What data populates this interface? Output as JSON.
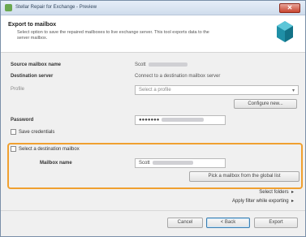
{
  "window": {
    "title": "Stellar Repair for Exchange - Preview",
    "close_label": "✕"
  },
  "header": {
    "title": "Export to mailbox",
    "description": "Select option to save the repaired mailboxes to live exchange server. This tool exports data to the server mailbox.",
    "logo_icon": "exchange-logo-icon"
  },
  "form": {
    "source_label": "Source mailbox name",
    "source_value": "Scott",
    "dest_server_label": "Destination server",
    "dest_server_value": "Connect to a destination mailbox server",
    "profile_label": "Profile",
    "profile_value": "Select a profile",
    "profile_button": "Configure new...",
    "password_label": "Password",
    "password_value": "●●●●●●●",
    "checkbox1_label": "Save credentials",
    "group_label": "Select a destination mailbox",
    "mailbox_label": "Mailbox name",
    "mailbox_value": "Scott",
    "pick_button": "Pick a mailbox from the global list",
    "link1": "Select folders",
    "link2": "Apply filter while exporting",
    "cancel": "Cancel",
    "back": "< Back",
    "next": "Export"
  }
}
